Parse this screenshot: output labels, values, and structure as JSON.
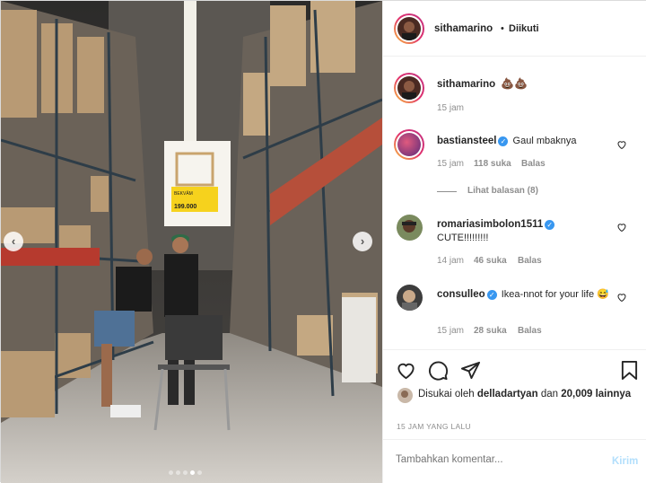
{
  "header": {
    "username": "sithamarino",
    "separator": "•",
    "follow_status": "Diikuti"
  },
  "caption": {
    "username": "sithamarino",
    "text": "💩💩",
    "time": "15 jam"
  },
  "sign": {
    "name": "BEKVÄM",
    "price": "199.000"
  },
  "comments": [
    {
      "username": "bastiansteel",
      "verified": true,
      "text": "Gaul mbaknya",
      "time": "15 jam",
      "likes": "118 suka",
      "reply": "Balas",
      "view_replies": "Lihat balasan (8)"
    },
    {
      "username": "romariasimbolon1511",
      "verified": true,
      "text": "CUTE!!!!!!!!!",
      "time": "14 jam",
      "likes": "46 suka",
      "reply": "Balas"
    },
    {
      "username": "consulleo",
      "verified": true,
      "text": "Ikea-nnot for your life 😅",
      "time": "15 jam",
      "likes": "28 suka",
      "reply": "Balas"
    }
  ],
  "likes": {
    "prefix": "Disukai oleh",
    "user": "delladartyan",
    "and": "dan",
    "count": "20,009 lainnya"
  },
  "post_time": "15 JAM YANG LALU",
  "add_comment": {
    "placeholder": "Tambahkan komentar...",
    "submit": "Kirim"
  },
  "carousel": {
    "total": 5,
    "active": 3
  },
  "icons": [
    "heart-icon",
    "comment-icon",
    "share-icon",
    "bookmark-icon",
    "chevron-left-icon",
    "chevron-right-icon",
    "verified-icon"
  ]
}
